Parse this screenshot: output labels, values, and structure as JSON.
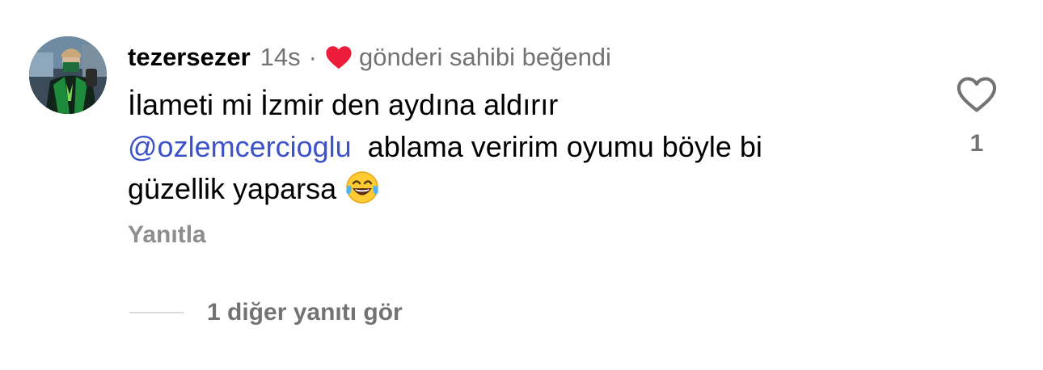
{
  "comment": {
    "username": "tezersezer",
    "time": "14s",
    "separator": "·",
    "liked_by_author_text": "gönderi sahibi beğendi",
    "text_line1": "İlameti mi İzmir den aydına aldırır",
    "mention": "@ozlemcercioglu",
    "text_line2_rest": "ablama veririm oyumu böyle bi",
    "text_line3": "güzellik yaparsa",
    "emoji": "😂",
    "like_count": "1",
    "reply_label": "Yanıtla",
    "more_replies_label": "1 diğer yanıtı gör"
  },
  "colors": {
    "liked_heart": "#ed1c3a",
    "mention": "#3b52c9",
    "secondary_text": "#737373"
  },
  "icons": {
    "liked_by_author": "filled-heart-icon",
    "like": "heart-outline-icon",
    "emoji": "tears-of-joy-emoji"
  }
}
